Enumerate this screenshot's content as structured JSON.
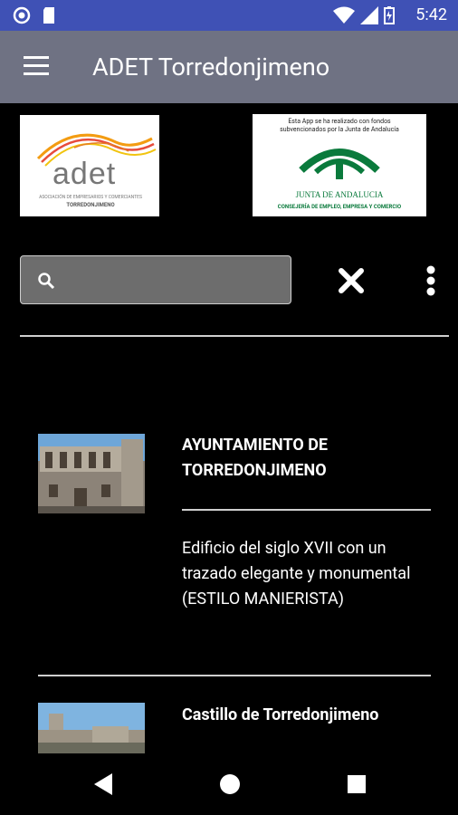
{
  "status": {
    "time": "5:42"
  },
  "app": {
    "title": "ADET Torredonjimeno"
  },
  "logos": {
    "adet": {
      "brand": "adet",
      "caption_line1": "ASOCIACIÓN DE EMPRESARIOS Y COMERCIANTES",
      "caption_line2": "TORREDONJIMENO"
    },
    "junta": {
      "note_line1": "Esta App se ha realizado con fondos",
      "note_line2": "subvencionados por la Junta de Andalucía",
      "name": "JUNTA DE ANDALUCIA",
      "dept": "CONSEJERÍA DE EMPLEO, EMPRESA Y COMERCIO"
    }
  },
  "search": {
    "value": "",
    "placeholder": ""
  },
  "places": [
    {
      "title": "AYUNTAMIENTO DE TORREDONJIMENO",
      "description": "Edificio del siglo XVII con un trazado elegante y monumental (ESTILO MANIERISTA)"
    },
    {
      "title": "Castillo de Torredonjimeno",
      "description": ""
    }
  ],
  "colors": {
    "appbar": "#6f7283",
    "statusbar": "#3f51b5",
    "background": "#000000"
  }
}
